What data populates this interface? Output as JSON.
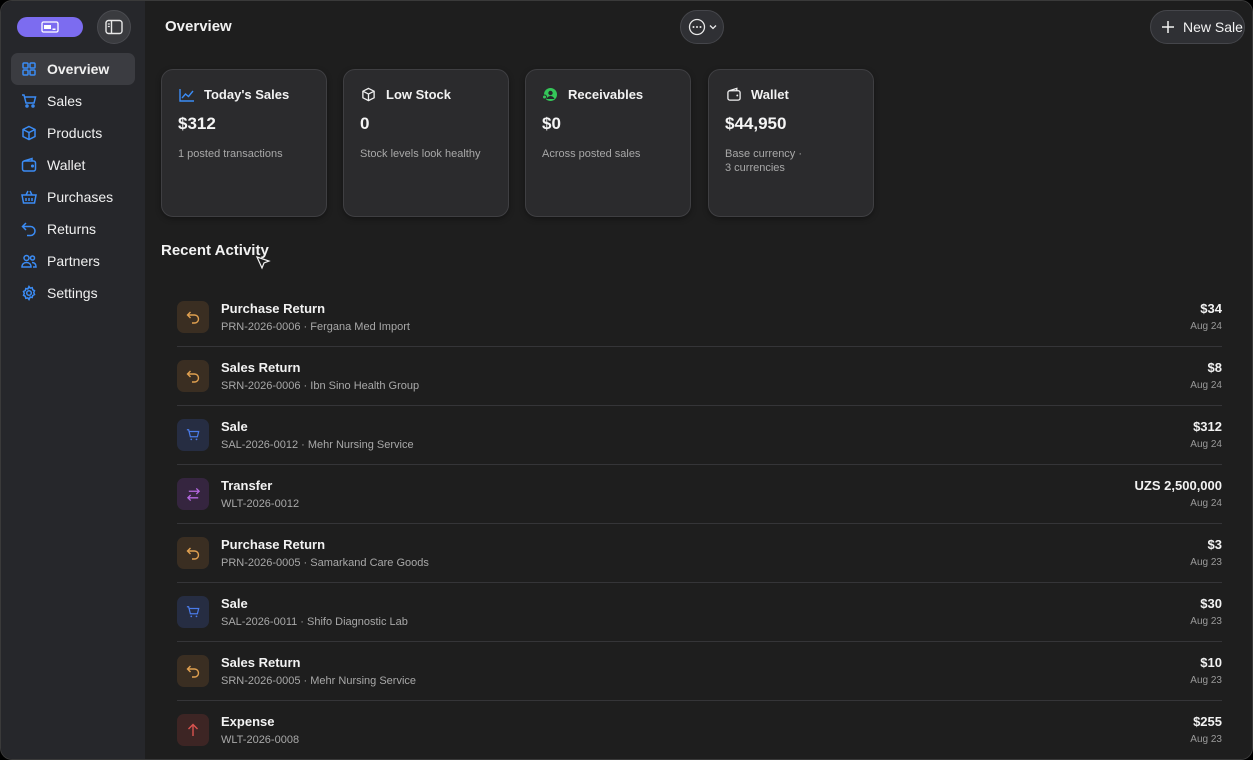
{
  "sidebar": {
    "items": [
      {
        "label": "Overview",
        "icon": "grid-icon",
        "active": true
      },
      {
        "label": "Sales",
        "icon": "cart-icon"
      },
      {
        "label": "Products",
        "icon": "cube-icon"
      },
      {
        "label": "Wallet",
        "icon": "wallet-icon"
      },
      {
        "label": "Purchases",
        "icon": "basket-icon"
      },
      {
        "label": "Returns",
        "icon": "return-arrow-icon"
      },
      {
        "label": "Partners",
        "icon": "people-icon"
      },
      {
        "label": "Settings",
        "icon": "gear-icon"
      }
    ]
  },
  "header": {
    "title": "Overview",
    "new_sale_label": "New Sale"
  },
  "cards": [
    {
      "title": "Today's Sales",
      "value": "$312",
      "sub": "1 posted transactions",
      "icon": "trend-chart-icon"
    },
    {
      "title": "Low Stock",
      "value": "0",
      "sub": "Stock levels look healthy",
      "icon": "cube-icon"
    },
    {
      "title": "Receivables",
      "value": "$0",
      "sub": "Across posted sales",
      "icon": "people-green-icon"
    },
    {
      "title": "Wallet",
      "value": "$44,950",
      "sub": "Base currency ·\n3 currencies",
      "icon": "wallet-icon"
    }
  ],
  "activity": {
    "title": "Recent Activity",
    "rows": [
      {
        "type": "purchase-return",
        "title": "Purchase Return",
        "sub": "PRN-2026-0006 · Fergana Med Import",
        "amount": "$34",
        "date": "Aug 24"
      },
      {
        "type": "sales-return",
        "title": "Sales Return",
        "sub": "SRN-2026-0006 · Ibn Sino Health Group",
        "amount": "$8",
        "date": "Aug 24"
      },
      {
        "type": "sale",
        "title": "Sale",
        "sub": "SAL-2026-0012 · Mehr Nursing Service",
        "amount": "$312",
        "date": "Aug 24"
      },
      {
        "type": "transfer",
        "title": "Transfer",
        "sub": "WLT-2026-0012",
        "amount": "UZS 2,500,000",
        "date": "Aug 24"
      },
      {
        "type": "purchase-return",
        "title": "Purchase Return",
        "sub": "PRN-2026-0005 · Samarkand Care Goods",
        "amount": "$3",
        "date": "Aug 23"
      },
      {
        "type": "sale",
        "title": "Sale",
        "sub": "SAL-2026-0011 · Shifo Diagnostic Lab",
        "amount": "$30",
        "date": "Aug 23"
      },
      {
        "type": "sales-return",
        "title": "Sales Return",
        "sub": "SRN-2026-0005 · Mehr Nursing Service",
        "amount": "$10",
        "date": "Aug 23"
      },
      {
        "type": "expense",
        "title": "Expense",
        "sub": "WLT-2026-0008",
        "amount": "$255",
        "date": "Aug 23"
      }
    ]
  },
  "colors": {
    "accent": "#3b8cf5",
    "badge": "#7c6cf0",
    "return": "#e0a050",
    "sale": "#4a7be8",
    "transfer": "#b468e0",
    "expense": "#d9534f",
    "receivables": "#34c759"
  }
}
